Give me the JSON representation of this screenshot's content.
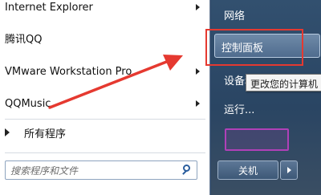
{
  "start_menu": {
    "programs": [
      {
        "label": "Internet Explorer",
        "has_submenu": true
      },
      {
        "label": "腾讯QQ",
        "has_submenu": false
      },
      {
        "label": "VMware Workstation Pro",
        "has_submenu": true
      },
      {
        "label": "QQMusic",
        "has_submenu": true
      }
    ],
    "all_programs_label": "所有程序",
    "search": {
      "placeholder": "搜索程序和文件"
    },
    "right_items": {
      "network": "网络",
      "control_panel": "控制面板",
      "devices": "设备和打印机",
      "run": "运行..."
    },
    "tooltip": "更改您的计算机",
    "shutdown_label": "关机"
  },
  "colors": {
    "annotation_red": "#e53930",
    "panel_bg": "#2f4a6a"
  }
}
